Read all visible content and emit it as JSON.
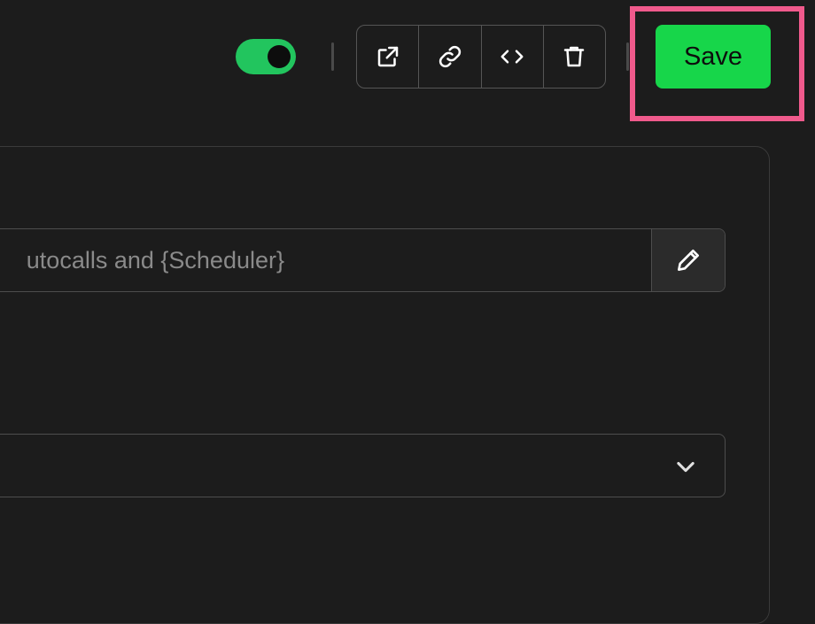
{
  "toolbar": {
    "toggle": {
      "state": "on",
      "color": "#22c55e"
    },
    "icons": [
      "external-link-icon",
      "link-icon",
      "code-icon",
      "trash-icon"
    ],
    "save_label": "Save",
    "save_color": "#17d64a",
    "highlight_color": "#f05a8c"
  },
  "form": {
    "text_value": "utocalls and {Scheduler}",
    "edit_icon": "pencil-icon",
    "select_icon": "chevron-down-icon",
    "select_value": ""
  }
}
